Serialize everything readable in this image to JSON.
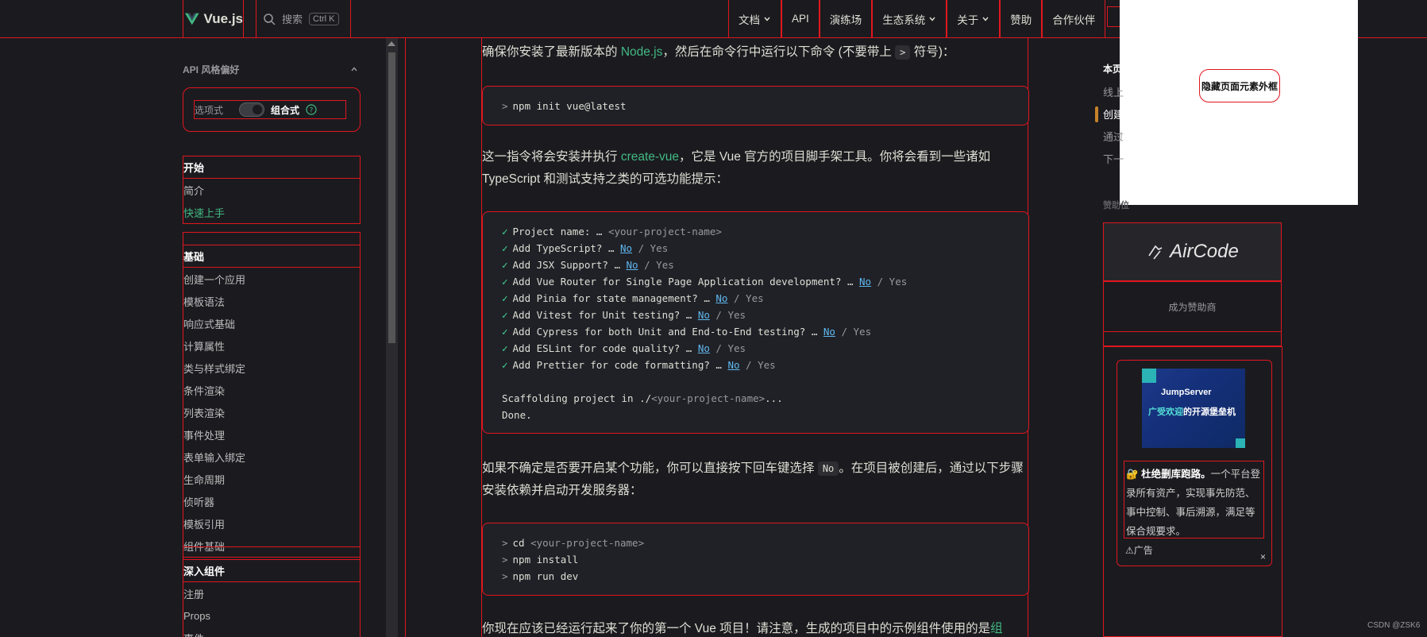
{
  "topnav": {
    "brand": "Vue.js",
    "search_label": "搜索",
    "search_kbd": "Ctrl K",
    "items": [
      {
        "label": "文档",
        "has_dropdown": true
      },
      {
        "label": "API",
        "has_dropdown": false
      },
      {
        "label": "演练场",
        "has_dropdown": false
      },
      {
        "label": "生态系统",
        "has_dropdown": true
      },
      {
        "label": "关于",
        "has_dropdown": true
      },
      {
        "label": "赞助",
        "has_dropdown": false
      },
      {
        "label": "合作伙伴",
        "has_dropdown": false
      }
    ]
  },
  "overlay": {
    "hide_button": "隐藏页面元素外框"
  },
  "sidebar": {
    "api_pref_title": "API 风格偏好",
    "api_option_options": "选项式",
    "api_option_composition": "组合式",
    "sections": [
      {
        "title": "开始",
        "items": [
          "简介",
          "快速上手"
        ]
      },
      {
        "title": "基础",
        "items": [
          "创建一个应用",
          "模板语法",
          "响应式基础",
          "计算属性",
          "类与样式绑定",
          "条件渲染",
          "列表渲染",
          "事件处理",
          "表单输入绑定",
          "生命周期",
          "侦听器",
          "模板引用",
          "组件基础"
        ]
      },
      {
        "title": "深入组件",
        "items": [
          "注册",
          "Props",
          "事件"
        ]
      }
    ],
    "active_item": "快速上手"
  },
  "main": {
    "p1_before": "确保你安装了最新版本的 ",
    "p1_link": "Node.js",
    "p1_after": "，然后在命令行中运行以下命令 (不要带上 ",
    "p1_code": ">",
    "p1_end": " 符号)：",
    "cmd1": "npm init vue@latest",
    "p2_before": "这一指令将会安装并执行 ",
    "p2_link": "create-vue",
    "p2_after": "，它是 Vue 官方的项目脚手架工具。你将会看到一些诸如 TypeScript 和测试支持之类的可选功能提示：",
    "prompts": [
      {
        "q": "Project name: … ",
        "placeholder": "<your-project-name>",
        "no": "",
        "yes": ""
      },
      {
        "q": "Add TypeScript? … ",
        "placeholder": "",
        "no": "No",
        "yes": "Yes"
      },
      {
        "q": "Add JSX Support? … ",
        "placeholder": "",
        "no": "No",
        "yes": "Yes"
      },
      {
        "q": "Add Vue Router for Single Page Application development? … ",
        "placeholder": "",
        "no": "No",
        "yes": "Yes"
      },
      {
        "q": "Add Pinia for state management? … ",
        "placeholder": "",
        "no": "No",
        "yes": "Yes"
      },
      {
        "q": "Add Vitest for Unit testing? … ",
        "placeholder": "",
        "no": "No",
        "yes": "Yes"
      },
      {
        "q": "Add Cypress for both Unit and End-to-End testing? … ",
        "placeholder": "",
        "no": "No",
        "yes": "Yes"
      },
      {
        "q": "Add ESLint for code quality? … ",
        "placeholder": "",
        "no": "No",
        "yes": "Yes"
      },
      {
        "q": "Add Prettier for code formatting? … ",
        "placeholder": "",
        "no": "No",
        "yes": "Yes"
      }
    ],
    "scaffold_line_before": "Scaffolding project in ./",
    "scaffold_line_ph": "<your-project-name>",
    "scaffold_line_after": "...",
    "done_line": "Done.",
    "p3_before": "如果不确定是否要开启某个功能，你可以直接按下回车键选择 ",
    "p3_code": "No",
    "p3_after": "。在项目被创建后，通过以下步骤安装依赖并启动开发服务器：",
    "cmd2_prefix": "cd ",
    "cmd2_ph": "<your-project-name>",
    "cmd3": "npm install",
    "cmd4": "npm run dev",
    "p4_before": "你现在应该已经运行起来了你的第一个 Vue 项目！请注意，生成的项目中的示例组件使用的是",
    "p4_link": "组"
  },
  "right": {
    "toc_label": "本页",
    "toc_items": [
      "线上",
      "创建",
      "通过",
      "下一"
    ],
    "sponsor_label": "赞助位",
    "sponsor_name": "AirCode",
    "become_sponsor": "成为赞助商",
    "ad_brand": "JumpServer",
    "ad_slogan_hl": "广受欢迎",
    "ad_slogan_rest": "的开源堡垒机",
    "ad_headline": "杜绝删库跑路。",
    "ad_body": "一个平台登录所有资产，实现事先防范、事中控制、事后溯源，满足等保合规要求。",
    "ad_tag": "广告",
    "ad_close": "×"
  },
  "footer_mark": "CSDN @ZSK6",
  "colors": {
    "accent": "#42b883",
    "outline": "#e0161f",
    "bg": "#1b1b1f",
    "code_bg": "#202127"
  }
}
